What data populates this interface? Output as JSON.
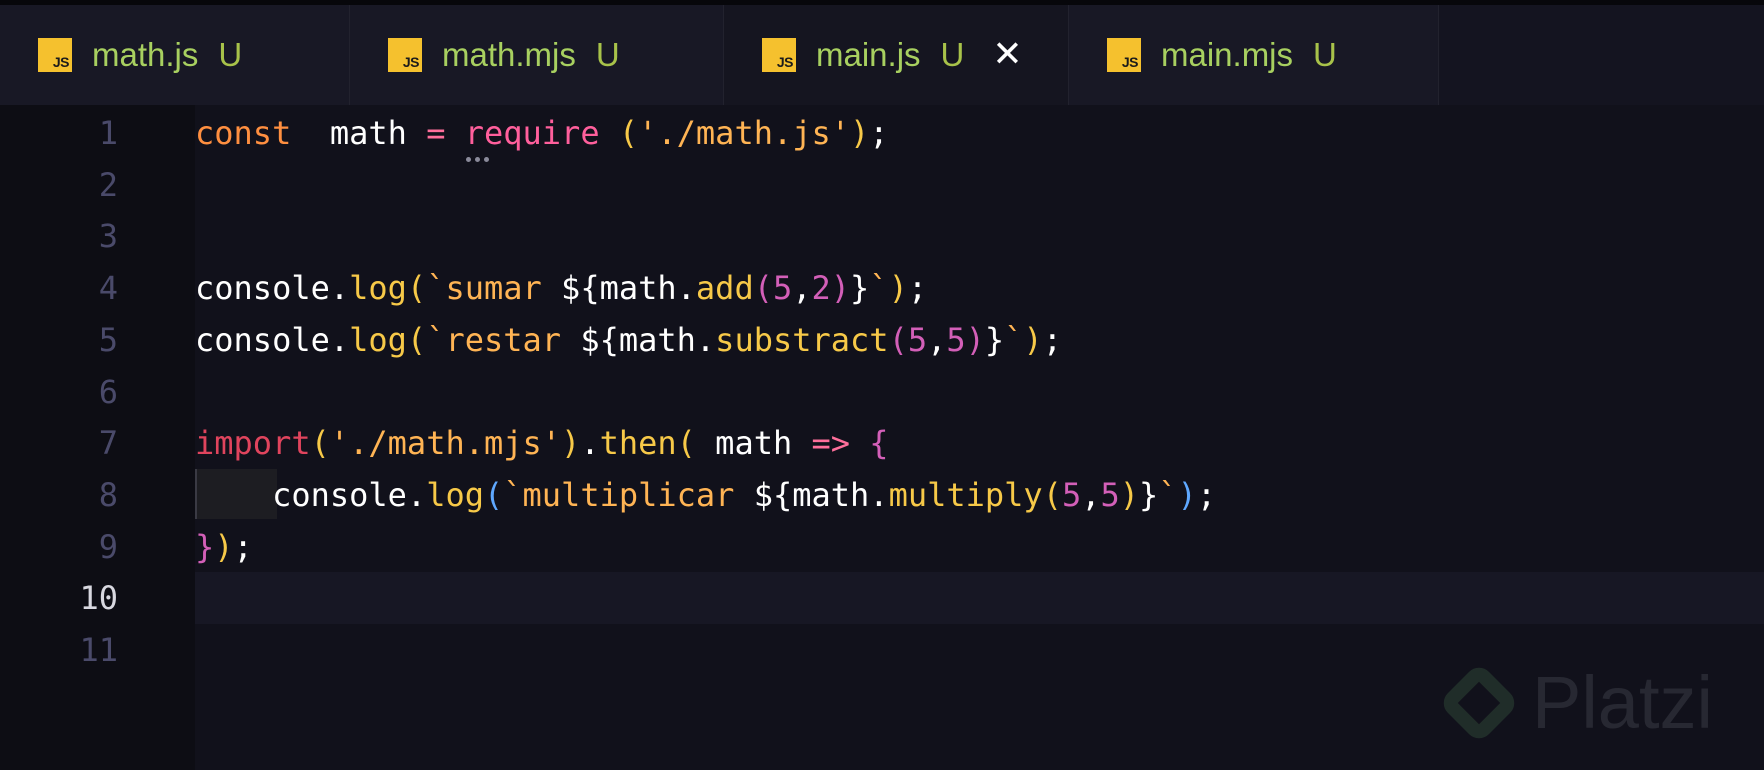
{
  "tabs": [
    {
      "icon": "js-file-icon",
      "icon_text": "JS",
      "label": "math.js",
      "status": "U",
      "active": false
    },
    {
      "icon": "js-file-icon",
      "icon_text": "JS",
      "label": "math.mjs",
      "status": "U",
      "active": false
    },
    {
      "icon": "js-file-icon",
      "icon_text": "JS",
      "label": "main.js",
      "status": "U",
      "active": true,
      "close": "✕"
    },
    {
      "icon": "js-file-icon",
      "icon_text": "JS",
      "label": "main.mjs",
      "status": "U",
      "active": false
    }
  ],
  "editor": {
    "current_line": 10,
    "lines": [
      {
        "num": "1",
        "tokens": [
          [
            "kw",
            "const"
          ],
          [
            "",
            "  math "
          ],
          [
            "op",
            "="
          ],
          [
            "",
            " "
          ],
          [
            "fn2",
            "require"
          ],
          [
            "",
            " "
          ],
          [
            "p1",
            "("
          ],
          [
            "str",
            "'./math.js'"
          ],
          [
            "p1",
            ")"
          ],
          [
            "",
            ";"
          ]
        ]
      },
      {
        "num": "2",
        "tokens": []
      },
      {
        "num": "3",
        "tokens": []
      },
      {
        "num": "4",
        "tokens": [
          [
            "",
            "console."
          ],
          [
            "fn",
            "log"
          ],
          [
            "p1",
            "("
          ],
          [
            "str",
            "`sumar "
          ],
          [
            "",
            "${math."
          ],
          [
            "fn",
            "add"
          ],
          [
            "p2",
            "("
          ],
          [
            "num",
            "5"
          ],
          [
            "",
            ","
          ],
          [
            "num",
            "2"
          ],
          [
            "p2",
            ")"
          ],
          [
            "",
            "}"
          ],
          [
            "str",
            "`"
          ],
          [
            "p1",
            ")"
          ],
          [
            "",
            ";"
          ]
        ]
      },
      {
        "num": "5",
        "tokens": [
          [
            "",
            "console."
          ],
          [
            "fn",
            "log"
          ],
          [
            "p1",
            "("
          ],
          [
            "str",
            "`restar "
          ],
          [
            "",
            "${math."
          ],
          [
            "fn",
            "substract"
          ],
          [
            "p2",
            "("
          ],
          [
            "num",
            "5"
          ],
          [
            "",
            ","
          ],
          [
            "num",
            "5"
          ],
          [
            "p2",
            ")"
          ],
          [
            "",
            "}"
          ],
          [
            "str",
            "`"
          ],
          [
            "p1",
            ")"
          ],
          [
            "",
            ";"
          ]
        ]
      },
      {
        "num": "6",
        "tokens": []
      },
      {
        "num": "7",
        "tokens": [
          [
            "kw2",
            "import"
          ],
          [
            "p1",
            "("
          ],
          [
            "str",
            "'./math.mjs'"
          ],
          [
            "p1",
            ")"
          ],
          [
            "",
            "."
          ],
          [
            "fn",
            "then"
          ],
          [
            "p1",
            "("
          ],
          [
            "",
            " math "
          ],
          [
            "op",
            "=>"
          ],
          [
            "",
            " "
          ],
          [
            "p2",
            "{"
          ]
        ]
      },
      {
        "num": "8",
        "tokens": [
          [
            "",
            "    console."
          ],
          [
            "fn",
            "log"
          ],
          [
            "p3",
            "("
          ],
          [
            "str",
            "`multiplicar "
          ],
          [
            "",
            "${math."
          ],
          [
            "fn",
            "multiply"
          ],
          [
            "p1",
            "("
          ],
          [
            "num",
            "5"
          ],
          [
            "",
            ","
          ],
          [
            "num",
            "5"
          ],
          [
            "p1",
            ")"
          ],
          [
            "",
            "}"
          ],
          [
            "str",
            "`"
          ],
          [
            "p3",
            ")"
          ],
          [
            "",
            ";"
          ]
        ]
      },
      {
        "num": "9",
        "tokens": [
          [
            "p2",
            "}"
          ],
          [
            "p1",
            ")"
          ],
          [
            "",
            ";"
          ]
        ]
      },
      {
        "num": "10",
        "tokens": []
      },
      {
        "num": "11",
        "tokens": []
      }
    ]
  },
  "watermark": {
    "text": "Platzi"
  },
  "colors": {
    "accent_untracked": "#a8c24a",
    "js_icon": "#f5c12e"
  }
}
